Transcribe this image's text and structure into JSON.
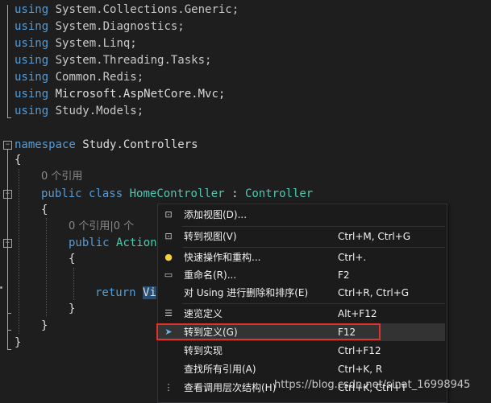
{
  "code": {
    "usings": [
      {
        "kw": "using",
        "ns": "System.Collections.Generic;"
      },
      {
        "kw": "using",
        "ns": "System.Diagnostics;"
      },
      {
        "kw": "using",
        "ns": "System.Linq;"
      },
      {
        "kw": "using",
        "ns": "System.Threading.Tasks;"
      },
      {
        "kw": "using",
        "ns": "Common.Redis;"
      },
      {
        "kw": "using",
        "ns": "Microsoft.AspNetCore.Mvc;"
      },
      {
        "kw": "using",
        "ns": "Study.Models;"
      }
    ],
    "namespace_kw": "namespace",
    "namespace_name": "Study.Controllers",
    "brace_open": "{",
    "brace_close": "}",
    "ref_hint_class": "0 个引用",
    "class_public": "public",
    "class_kw": "class",
    "class_name": "HomeController",
    "class_colon": ":",
    "class_base": "Controller",
    "ref_hint_method": "0 个引用|0 个",
    "method_public": "public",
    "method_partial": "Action",
    "return_kw": "return",
    "return_partial": "Vi"
  },
  "context_menu": {
    "items": [
      {
        "icon": "add-view-icon",
        "glyph": "⊡",
        "label": "添加视图(D)...",
        "shortcut": ""
      },
      {
        "icon": "go-to-view-icon",
        "glyph": "⊡",
        "label": "转到视图(V)",
        "shortcut": "Ctrl+M, Ctrl+G"
      },
      {
        "icon": "lightbulb-icon",
        "glyph": "💡",
        "label": "快速操作和重构...",
        "shortcut": "Ctrl+."
      },
      {
        "icon": "rename-icon",
        "glyph": "▭",
        "label": "重命名(R)...",
        "shortcut": "F2"
      },
      {
        "icon": "",
        "glyph": "",
        "label": "对 Using 进行删除和排序(E)",
        "shortcut": "Ctrl+R, Ctrl+G"
      },
      {
        "icon": "peek-definition-icon",
        "glyph": "☰",
        "label": "速览定义",
        "shortcut": "Alt+F12"
      },
      {
        "icon": "go-to-definition-icon",
        "glyph": "➤",
        "label": "转到定义(G)",
        "shortcut": "F12"
      },
      {
        "icon": "",
        "glyph": "",
        "label": "转到实现",
        "shortcut": "Ctrl+F12"
      },
      {
        "icon": "",
        "glyph": "",
        "label": "查找所有引用(A)",
        "shortcut": "Ctrl+K, R"
      },
      {
        "icon": "call-hierarchy-icon",
        "glyph": "⋮",
        "label": "查看调用层次结构(H)",
        "shortcut": "Ctrl+K, Ctrl+T"
      }
    ],
    "highlighted_index": 6
  },
  "watermark": "https://blog.csdn.net/sinat_16998945",
  "colors": {
    "keyword": "#569cd6",
    "type": "#4ec9b0",
    "highlight_box": "#e0322d"
  }
}
